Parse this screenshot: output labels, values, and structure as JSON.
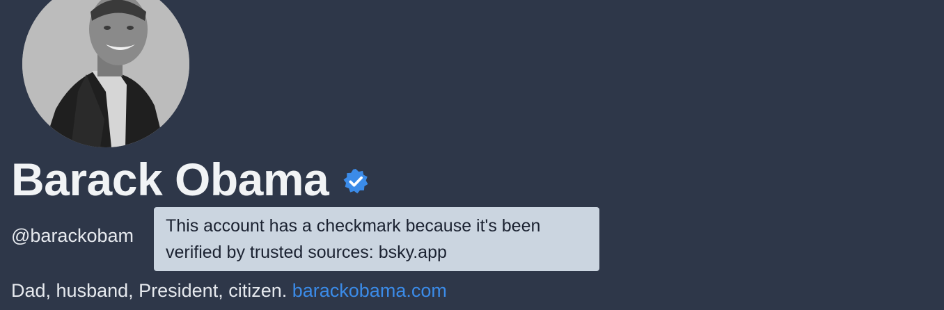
{
  "profile": {
    "display_name": "Barack Obama",
    "handle": "@barackobam",
    "bio_text": "Dad, husband, President, citizen. ",
    "bio_link": "barackobama.com"
  },
  "tooltip": {
    "text": "This account has a checkmark because it's been verified by trusted sources: bsky.app"
  },
  "icons": {
    "verified": "verified-check-badge-icon"
  },
  "colors": {
    "background": "#2e3749",
    "link": "#3b8be8",
    "verified_badge": "#3b8be8",
    "tooltip_bg": "#cbd5e0"
  }
}
